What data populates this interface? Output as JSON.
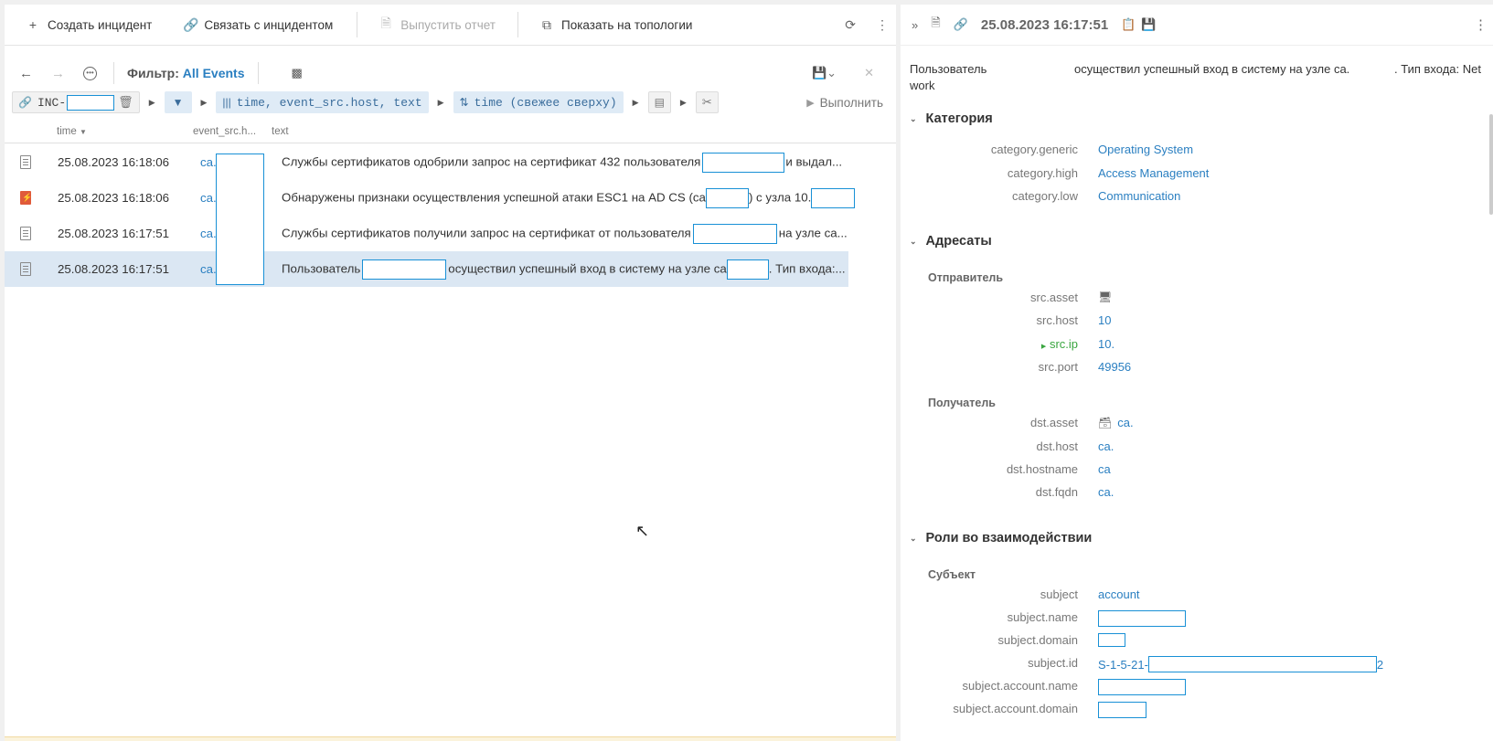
{
  "toolbar": {
    "create_incident": "Создать инцидент",
    "link_incident": "Связать с инцидентом",
    "release_report": "Выпустить отчет",
    "show_topology": "Показать на топологии"
  },
  "filter": {
    "label": "Фильтр:",
    "value": "All Events",
    "incident_prefix": "INC-",
    "fields_chip": "time, event_src.host, text",
    "sort_chip": "time (свежее сверху)",
    "run_label": "Выполнить"
  },
  "table": {
    "columns": [
      "time",
      "event_src.h...",
      "text"
    ],
    "rows": [
      {
        "icon": "document-icon",
        "time": "25.08.2023 16:18:06",
        "host": "ca.",
        "text_a": "Службы сертификатов одобрили запрос на сертификат 432 пользователя",
        "text_b": "и выдал..."
      },
      {
        "icon": "alert-icon",
        "time": "25.08.2023 16:18:06",
        "host": "ca.",
        "text_a": "Обнаружены признаки осуществления успешной атаки ESC1 на AD CS (ca",
        "text_b": ") с узла 10."
      },
      {
        "icon": "document-icon",
        "time": "25.08.2023 16:17:51",
        "host": "ca.",
        "text_a": "Службы сертификатов получили запрос на сертификат от пользователя",
        "text_b": "на узле ca..."
      },
      {
        "icon": "document-icon",
        "time": "25.08.2023 16:17:51",
        "host": "ca.",
        "text_a": "Пользователь",
        "text_b": "осуществил успешный вход в систему на узле ca",
        "text_c": ". Тип входа:..."
      }
    ]
  },
  "detail": {
    "title": "25.08.2023 16:17:51",
    "message_a": "Пользователь",
    "message_b": "осуществил успешный вход в систему на узле ca.",
    "message_c": ". Тип входа: Net",
    "message_d": "work",
    "section_category": "Категория",
    "category": [
      {
        "key": "category.generic",
        "value": "Operating System"
      },
      {
        "key": "category.high",
        "value": "Access Management"
      },
      {
        "key": "category.low",
        "value": "Communication"
      }
    ],
    "section_addressees": "Адресаты",
    "sender": "Отправитель",
    "src": [
      {
        "key": "src.asset",
        "value": ""
      },
      {
        "key": "src.host",
        "value": "10"
      },
      {
        "key": "src.ip",
        "value": "10."
      },
      {
        "key": "src.port",
        "value": "49956"
      }
    ],
    "receiver": "Получатель",
    "dst": [
      {
        "key": "dst.asset",
        "value": "ca."
      },
      {
        "key": "dst.host",
        "value": "ca."
      },
      {
        "key": "dst.hostname",
        "value": "ca"
      },
      {
        "key": "dst.fqdn",
        "value": "ca."
      }
    ],
    "section_roles": "Роли во взаимодействии",
    "subject_label": "Субъект",
    "subject": [
      {
        "key": "subject",
        "value": "account"
      },
      {
        "key": "subject.name",
        "value": ""
      },
      {
        "key": "subject.domain",
        "value": ""
      },
      {
        "key": "subject.id",
        "value": "S-1-5-21-",
        "suffix": "2"
      },
      {
        "key": "subject.account.name",
        "value": ""
      },
      {
        "key": "subject.account.domain",
        "value": ""
      }
    ]
  },
  "colors": {
    "accent": "#2a7fc1",
    "selected_row": "#dbe7f3",
    "redaction_border": "#1890d6",
    "alert": "#e05a3a"
  }
}
